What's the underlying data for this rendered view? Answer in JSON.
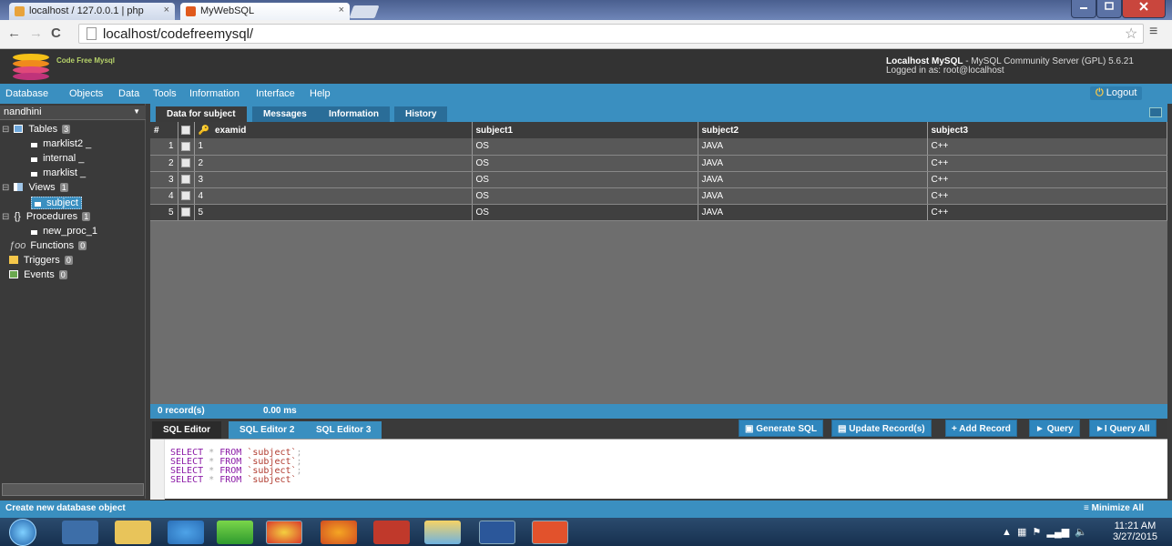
{
  "browser": {
    "tabs": [
      {
        "label": "localhost / 127.0.0.1 | php"
      },
      {
        "label": "MyWebSQL"
      }
    ],
    "tab_close": "×",
    "url": "localhost/codefreemysql/"
  },
  "app": {
    "name": "Code Free Mysql",
    "server_name": "Localhost MySQL",
    "server_detail": " - MySQL Community Server (GPL) 5.6.21",
    "logged_in": "Logged in as: root@localhost"
  },
  "menu": [
    "Database",
    "Objects",
    "Data",
    "Tools",
    "Information",
    "Interface",
    "Help"
  ],
  "logout": "Logout",
  "sidebar": {
    "database": "nandhini",
    "tables_label": "Tables",
    "tables_count": "3",
    "tables": [
      "marklist2",
      "internal",
      "marklist"
    ],
    "views_label": "Views",
    "views_count": "1",
    "views": [
      "subject"
    ],
    "procedures_label": "Procedures",
    "procedures_count": "1",
    "procedures": [
      "new_proc_1"
    ],
    "functions_label": "Functions",
    "functions_count": "0",
    "triggers_label": "Triggers",
    "triggers_count": "0",
    "events_label": "Events",
    "events_count": "0"
  },
  "result_tabs": [
    "Data for subject",
    "Messages",
    "Information",
    "History"
  ],
  "grid": {
    "columns": [
      "#",
      "examid",
      "subject1",
      "subject2",
      "subject3"
    ],
    "rows": [
      {
        "n": "1",
        "examid": "1",
        "subject1": "OS",
        "subject2": "JAVA",
        "subject3": "C++"
      },
      {
        "n": "2",
        "examid": "2",
        "subject1": "OS",
        "subject2": "JAVA",
        "subject3": "C++"
      },
      {
        "n": "3",
        "examid": "3",
        "subject1": "OS",
        "subject2": "JAVA",
        "subject3": "C++"
      },
      {
        "n": "4",
        "examid": "4",
        "subject1": "OS",
        "subject2": "JAVA",
        "subject3": "C++"
      },
      {
        "n": "5",
        "examid": "5",
        "subject1": "OS",
        "subject2": "JAVA",
        "subject3": "C++"
      }
    ]
  },
  "status": {
    "records": "0 record(s)",
    "time": "0.00 ms"
  },
  "editor_tabs": [
    "SQL Editor",
    "SQL Editor 2",
    "SQL Editor 3"
  ],
  "editor_buttons": [
    "Generate SQL",
    "Update Record(s)",
    "Add Record",
    "Query",
    "Query All"
  ],
  "sql_lines": [
    {
      "select": "SELECT",
      "star": "*",
      "from": "FROM",
      "table": "`subject`",
      "end": ";"
    },
    {
      "select": "SELECT",
      "star": "*",
      "from": "FROM",
      "table": "`subject`",
      "end": ";"
    },
    {
      "select": "SELECT",
      "star": "*",
      "from": "FROM",
      "table": "`subject`",
      "end": ";"
    },
    {
      "select": "SELECT",
      "star": "*",
      "from": "FROM",
      "table": "`subject`",
      "end": ""
    }
  ],
  "bottom": {
    "create": "Create new database object",
    "minimize": "Minimize All"
  },
  "taskbar": {
    "time": "11:21 AM",
    "date": "3/27/2015"
  },
  "colors": {
    "accent": "#3a8fc0",
    "background": "#3b3b3b",
    "logo_green": "#b7d36a"
  }
}
